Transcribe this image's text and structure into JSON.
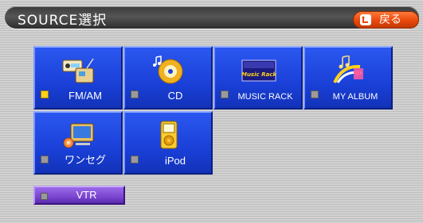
{
  "header": {
    "title": "SOURCE選択",
    "back_label": "戻る"
  },
  "sources": [
    {
      "label": "FM/AM",
      "active": true,
      "icon": "radio-icon"
    },
    {
      "label": "CD",
      "active": false,
      "icon": "cd-icon"
    },
    {
      "label": "MUSIC RACK",
      "active": false,
      "icon": "music-rack-icon",
      "icon_text": "Music Rack"
    },
    {
      "label": "MY ALBUM",
      "active": false,
      "icon": "my-album-icon"
    },
    {
      "label": "ワンセグ",
      "active": false,
      "icon": "tv-icon"
    },
    {
      "label": "iPod",
      "active": false,
      "icon": "ipod-icon"
    }
  ],
  "vtr": {
    "label": "VTR",
    "active": false
  },
  "colors": {
    "tile": "#1a40d8",
    "vtr": "#7a45d0",
    "back_button": "#e8480c",
    "led_on": "#ffd21a",
    "led_off": "#9a9a9a"
  }
}
